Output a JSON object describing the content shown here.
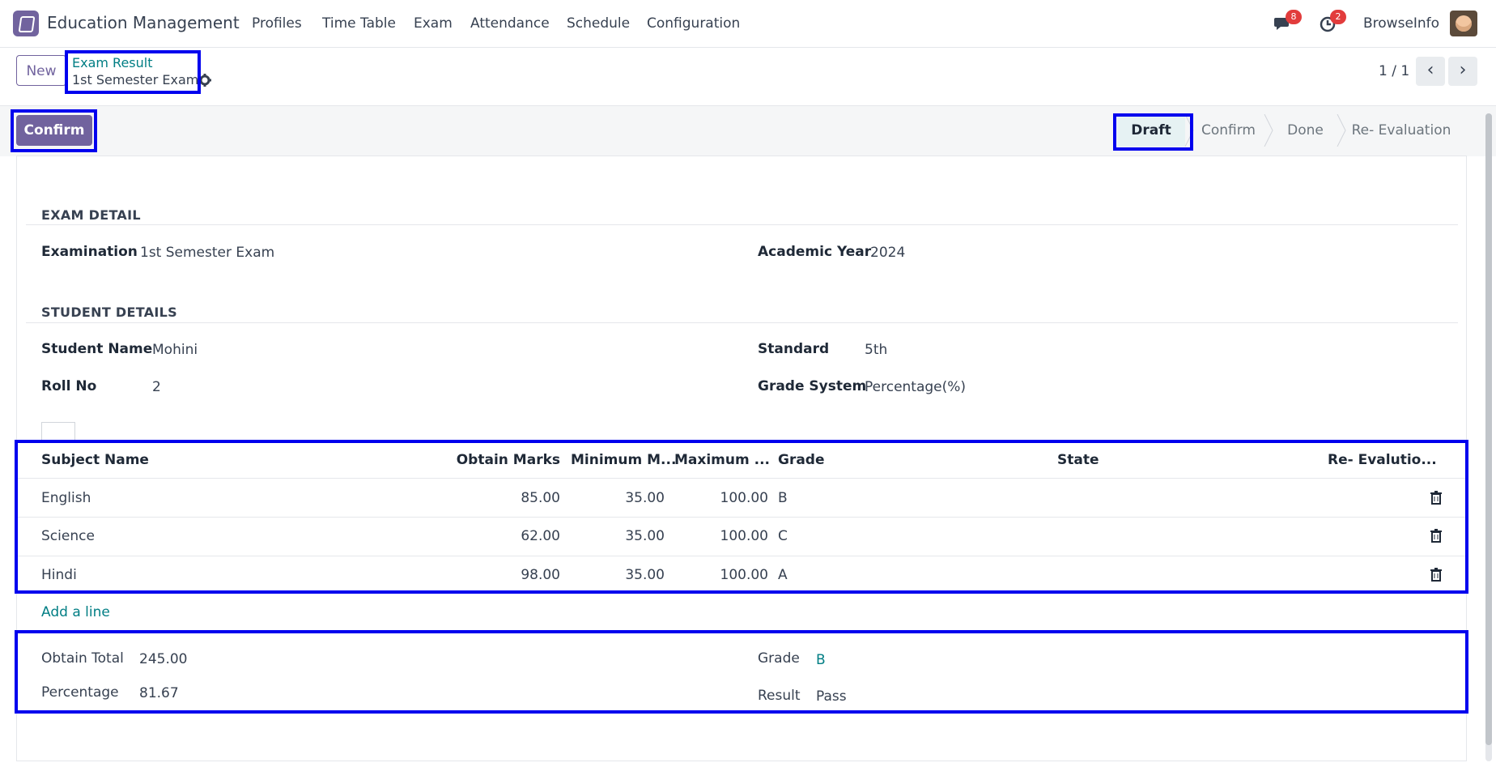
{
  "nav": {
    "app_title": "Education Management",
    "menu": [
      "Profiles",
      "Time Table",
      "Exam",
      "Attendance",
      "Schedule",
      "Configuration"
    ],
    "messages_count": "8",
    "activities_count": "2",
    "user": "BrowseInfo"
  },
  "control": {
    "new_label": "New",
    "breadcrumb_parent": "Exam Result",
    "breadcrumb_current": "1st Semester Exam",
    "pager": "1 / 1"
  },
  "status": {
    "confirm_label": "Confirm",
    "stages": [
      "Draft",
      "Confirm",
      "Done",
      "Re- Evaluation"
    ],
    "active_stage": "Draft"
  },
  "exam_detail": {
    "title": "EXAM DETAIL",
    "examination_label": "Examination",
    "examination_value": "1st Semester Exam",
    "year_label": "Academic Year",
    "year_value": "2024"
  },
  "student_details": {
    "title": "STUDENT DETAILS",
    "name_label": "Student Name",
    "name_value": "Mohini",
    "standard_label": "Standard",
    "standard_value": "5th",
    "roll_label": "Roll No",
    "roll_value": "2",
    "grade_system_label": "Grade System",
    "grade_system_value": "Percentage(%)"
  },
  "table": {
    "headers": [
      "Subject Name",
      "Obtain Marks",
      "Minimum M...",
      "Maximum ...",
      "Grade",
      "State",
      "Re- Evalutio..."
    ],
    "rows": [
      {
        "subject": "English",
        "obtain": "85.00",
        "min": "35.00",
        "max": "100.00",
        "grade": "B"
      },
      {
        "subject": "Science",
        "obtain": "62.00",
        "min": "35.00",
        "max": "100.00",
        "grade": "C"
      },
      {
        "subject": "Hindi",
        "obtain": "98.00",
        "min": "35.00",
        "max": "100.00",
        "grade": "A"
      }
    ],
    "add_line": "Add a line"
  },
  "totals": {
    "obtain_total_label": "Obtain Total",
    "obtain_total_value": "245.00",
    "percentage_label": "Percentage",
    "percentage_value": "81.67",
    "grade_label": "Grade",
    "grade_value": "B",
    "result_label": "Result",
    "result_value": "Pass"
  },
  "colors": {
    "brand": "#71639e",
    "link": "#017e84",
    "highlight": "#0000ee"
  }
}
